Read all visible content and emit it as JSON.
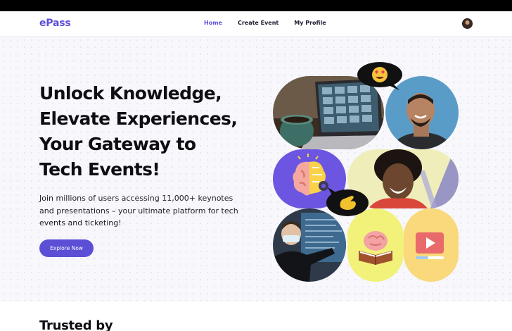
{
  "brand": {
    "name": "ePass",
    "accent": "#5b4fd6"
  },
  "nav": {
    "links": [
      {
        "label": "Home",
        "active": true
      },
      {
        "label": "Create Event",
        "active": false
      },
      {
        "label": "My Profile",
        "active": false
      }
    ]
  },
  "hero": {
    "headline": [
      "Unlock Knowledge,",
      "Elevate Experiences,",
      "Your Gateway to",
      "Tech Events!"
    ],
    "subtext": [
      "Join millions of users accessing 11,000+ keynotes",
      "and presentations – your ultimate platform for tech",
      "events and ticketing!"
    ],
    "cta_label": "Explore Now"
  },
  "collage": {
    "tiles": [
      {
        "subject": "laptop-video-call-photo"
      },
      {
        "subject": "smiling-man-photo"
      },
      {
        "subject": "brain-idea-illustration",
        "color": "#6c55e0"
      },
      {
        "subject": "laughing-woman-photo",
        "color": "#efeebb"
      },
      {
        "subject": "presenter-photo"
      },
      {
        "subject": "brain-book-illustration",
        "color": "#f2f27a"
      },
      {
        "subject": "video-play-illustration",
        "color": "#f9d97b"
      }
    ],
    "bubbles": [
      {
        "icon": "heart-eyes-emoji-icon"
      },
      {
        "icon": "waving-hand-icon"
      }
    ]
  },
  "trusted": {
    "title": "Trusted by"
  }
}
